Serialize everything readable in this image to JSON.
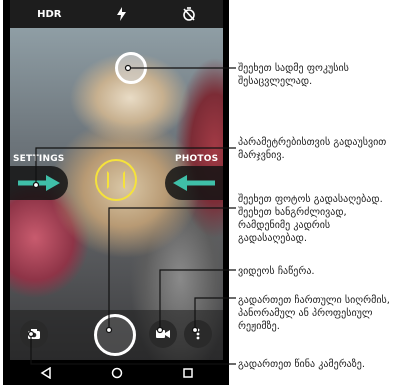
{
  "camera": {
    "top_bar": {
      "hdr_label": "HDR"
    },
    "left_label": "SETTINGS",
    "right_label": "PHOTOS"
  },
  "annotations": [
    "შეეხეთ სადმე ფოკუსის შესაცვლელად.",
    "პარამეტრებისთვის გადაუსვით მარჯვნივ.",
    "შეეხეთ ფოტოს გადასაღებად. შეეხეთ ხანგრძლივად, რამდენიმე კადრის გადასაღებად.",
    "ვიდეოს ჩაწერა.",
    "გადართეთ ჩართული სიღრმის, პანორამულ ან პროფესიულ რეჟიმზე.",
    "გადართეთ წინა კამერაზე."
  ],
  "colors": {
    "accent_teal": "#3fbfa8",
    "focus_yellow": "#f5e23b"
  },
  "icons": {
    "top_bar": [
      "hdr-icon",
      "flash-auto-icon",
      "timer-off-icon"
    ],
    "controls": [
      "switch-camera-icon",
      "shutter-button",
      "video-camera-icon",
      "more-vertical-icon"
    ],
    "nav": [
      "back-icon",
      "home-icon",
      "recents-icon"
    ]
  }
}
